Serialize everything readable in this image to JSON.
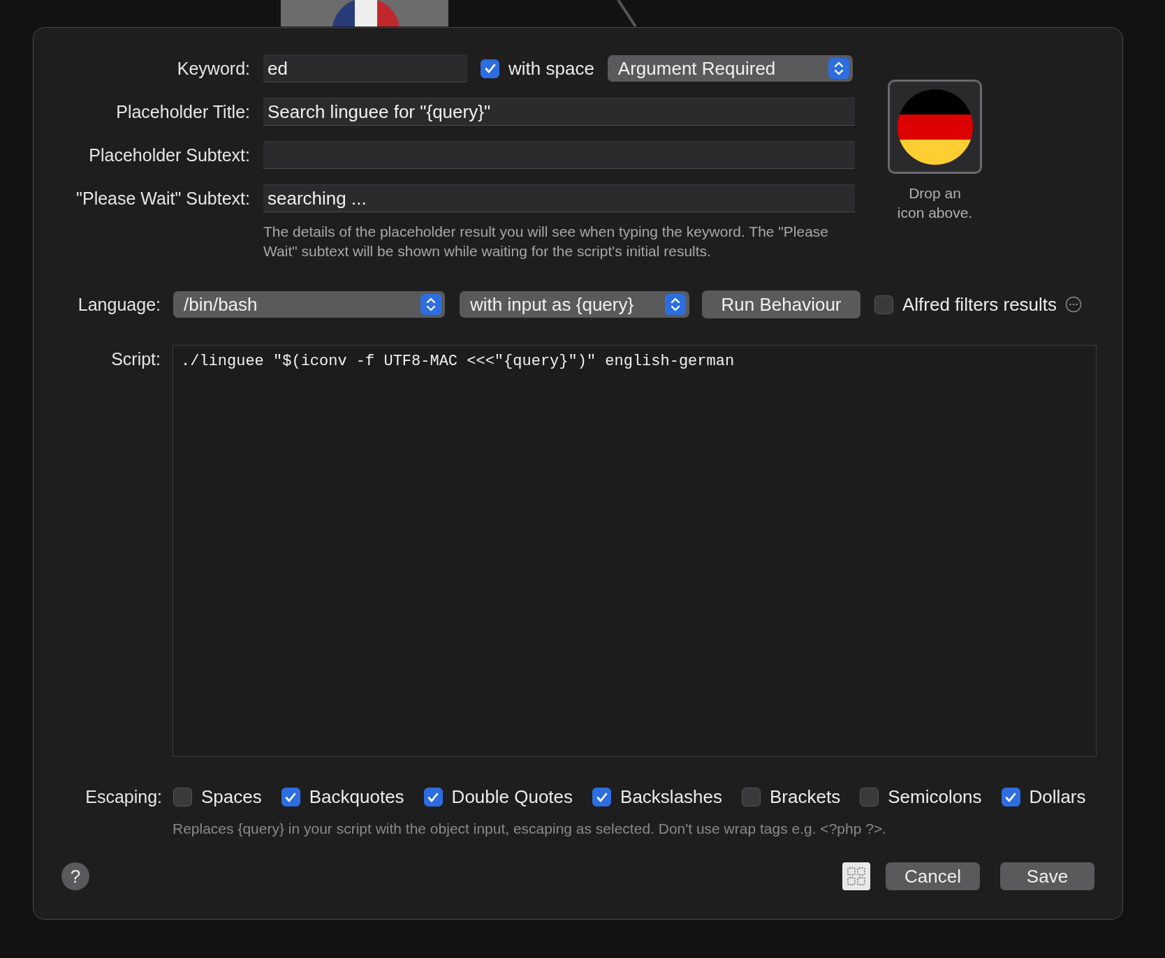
{
  "keyword": {
    "label": "Keyword:",
    "value": "ed"
  },
  "with_space": {
    "label": "with space",
    "checked": true
  },
  "argument": {
    "value": "Argument Required"
  },
  "fields": [
    {
      "label": "Placeholder Title:",
      "value": "Search linguee for \"{query}\""
    },
    {
      "label": "Placeholder Subtext:"
    },
    {
      "label": "\"Please Wait\" Subtext:",
      "value": "searching ..."
    }
  ],
  "fields_hint": "The details of the placeholder result you will see when typing the keyword. The \"Please Wait\" subtext will be shown while waiting for the script's initial results.",
  "icon_well": {
    "caption": "Drop an icon above."
  },
  "language": {
    "label": "Language:",
    "interpreter": "/bin/bash",
    "input_mode": "with input as {query}"
  },
  "run_button": "Run Behaviour",
  "alfred_filters": {
    "label": "Alfred filters results",
    "checked": false
  },
  "script": {
    "label": "Script:",
    "code": "./linguee \"$(iconv -f UTF8-MAC <<<\"{query}\")\" english-german"
  },
  "escaping": {
    "label": "Escaping:",
    "options": [
      {
        "label": "Spaces",
        "checked": false
      },
      {
        "label": "Backquotes",
        "checked": true
      },
      {
        "label": "Double Quotes",
        "checked": true
      },
      {
        "label": "Backslashes",
        "checked": true
      },
      {
        "label": "Brackets",
        "checked": false
      },
      {
        "label": "Semicolons",
        "checked": false
      },
      {
        "label": "Dollars",
        "checked": true
      }
    ]
  },
  "escaping_note": "Replaces {query} in your script with the object input, escaping as selected. Don't use wrap tags e.g. <?php ?>.",
  "help_button": "?",
  "buttons": [
    "Cancel",
    "Save"
  ]
}
